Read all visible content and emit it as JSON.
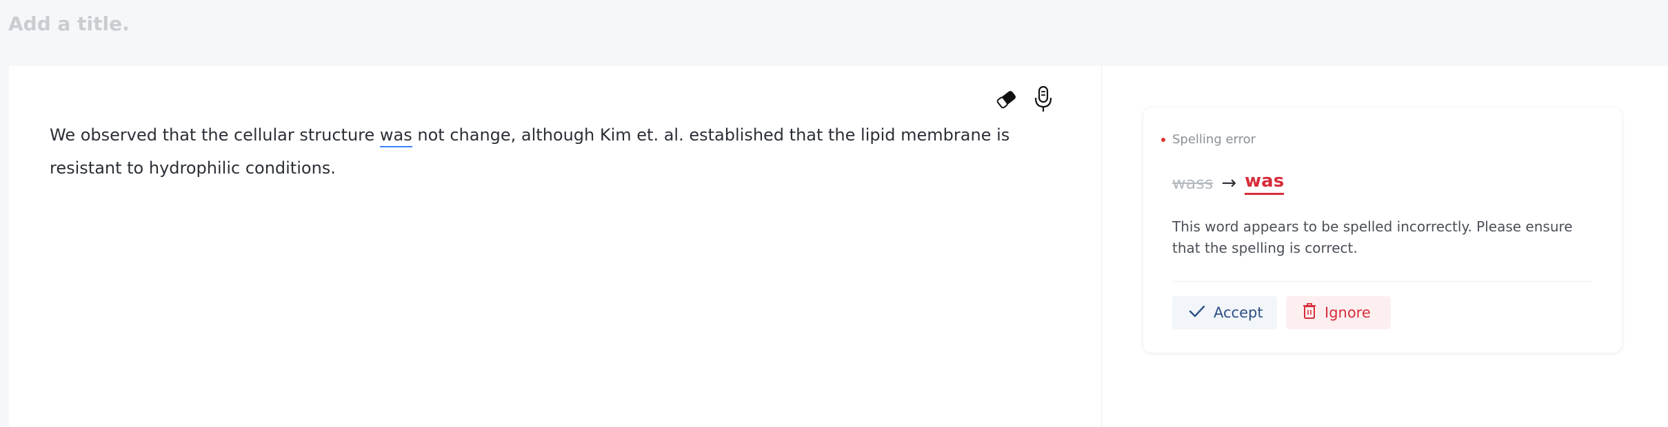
{
  "title": {
    "placeholder": "Add a title."
  },
  "editor": {
    "paragraph_before": "We observed that the cellular structure ",
    "flagged_word": "was",
    "paragraph_after": " not change, although Kim et. al. established that the lipid membrane is resistant to hydrophilic conditions.",
    "tools": [
      "eraser-icon",
      "microphone-icon"
    ]
  },
  "suggestion": {
    "category": "Spelling error",
    "original": "wass",
    "replacement": "was",
    "explanation": "This word appears to be spelled incorrectly. Please ensure that the spelling is correct.",
    "accept_label": "Accept",
    "ignore_label": "Ignore"
  },
  "colors": {
    "error_red": "#d62d3a",
    "accent_blue": "#3b82f6",
    "accept_text": "#2c4f84"
  }
}
